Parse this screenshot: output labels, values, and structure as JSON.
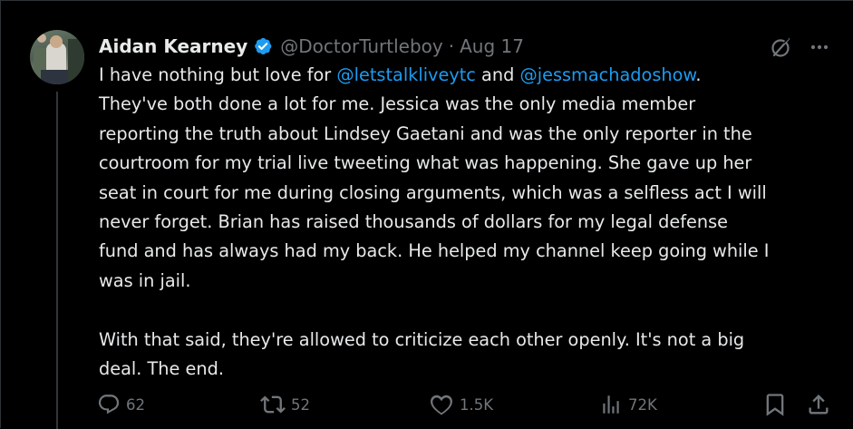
{
  "author": {
    "name": "Aidan Kearney",
    "handle": "@DoctorTurtleboy",
    "separator": "·",
    "date": "Aug 17",
    "verified_color": "#1d9bf0"
  },
  "tweet": {
    "lines": [
      {
        "segments": [
          {
            "text": "I have nothing but love for ",
            "type": "text"
          },
          {
            "text": "@letstalkliveytc",
            "type": "mention"
          },
          {
            "text": " and ",
            "type": "text"
          },
          {
            "text": "@jessmachadoshow",
            "type": "mention"
          },
          {
            "text": ".",
            "type": "text"
          }
        ]
      },
      {
        "segments": [
          {
            "text": "They've both done a lot for me. Jessica was the only media member",
            "type": "text"
          }
        ]
      },
      {
        "segments": [
          {
            "text": "reporting the truth about Lindsey Gaetani and was the only reporter in the",
            "type": "text"
          }
        ]
      },
      {
        "segments": [
          {
            "text": "courtroom for my trial live tweeting what was happening. She gave up her",
            "type": "text"
          }
        ]
      },
      {
        "segments": [
          {
            "text": "seat in court for me during closing arguments, which was a selfless act I will",
            "type": "text"
          }
        ]
      },
      {
        "segments": [
          {
            "text": "never forget. Brian has raised thousands of dollars for my legal defense",
            "type": "text"
          }
        ]
      },
      {
        "segments": [
          {
            "text": "fund and has always had my back. He helped my channel keep going while I",
            "type": "text"
          }
        ]
      },
      {
        "segments": [
          {
            "text": "was in jail.",
            "type": "text"
          }
        ]
      },
      {
        "segments": []
      },
      {
        "segments": [
          {
            "text": "With that said, they're allowed to criticize each other openly. It's not a big",
            "type": "text"
          }
        ]
      },
      {
        "segments": [
          {
            "text": "deal. The end.",
            "type": "text"
          }
        ]
      }
    ]
  },
  "actions": {
    "replies": "62",
    "reposts": "52",
    "likes": "1.5K",
    "views": "72K"
  },
  "icons": {
    "reply": "reply-icon",
    "repost": "repost-icon",
    "like": "heart-icon",
    "views": "views-icon",
    "bookmark": "bookmark-icon",
    "share": "share-icon",
    "grok": "grok-icon",
    "more": "more-icon"
  },
  "colors": {
    "background": "#000000",
    "text": "#e7e9ea",
    "secondary": "#71767b",
    "link": "#1d9bf0",
    "divider": "#2f3336"
  }
}
